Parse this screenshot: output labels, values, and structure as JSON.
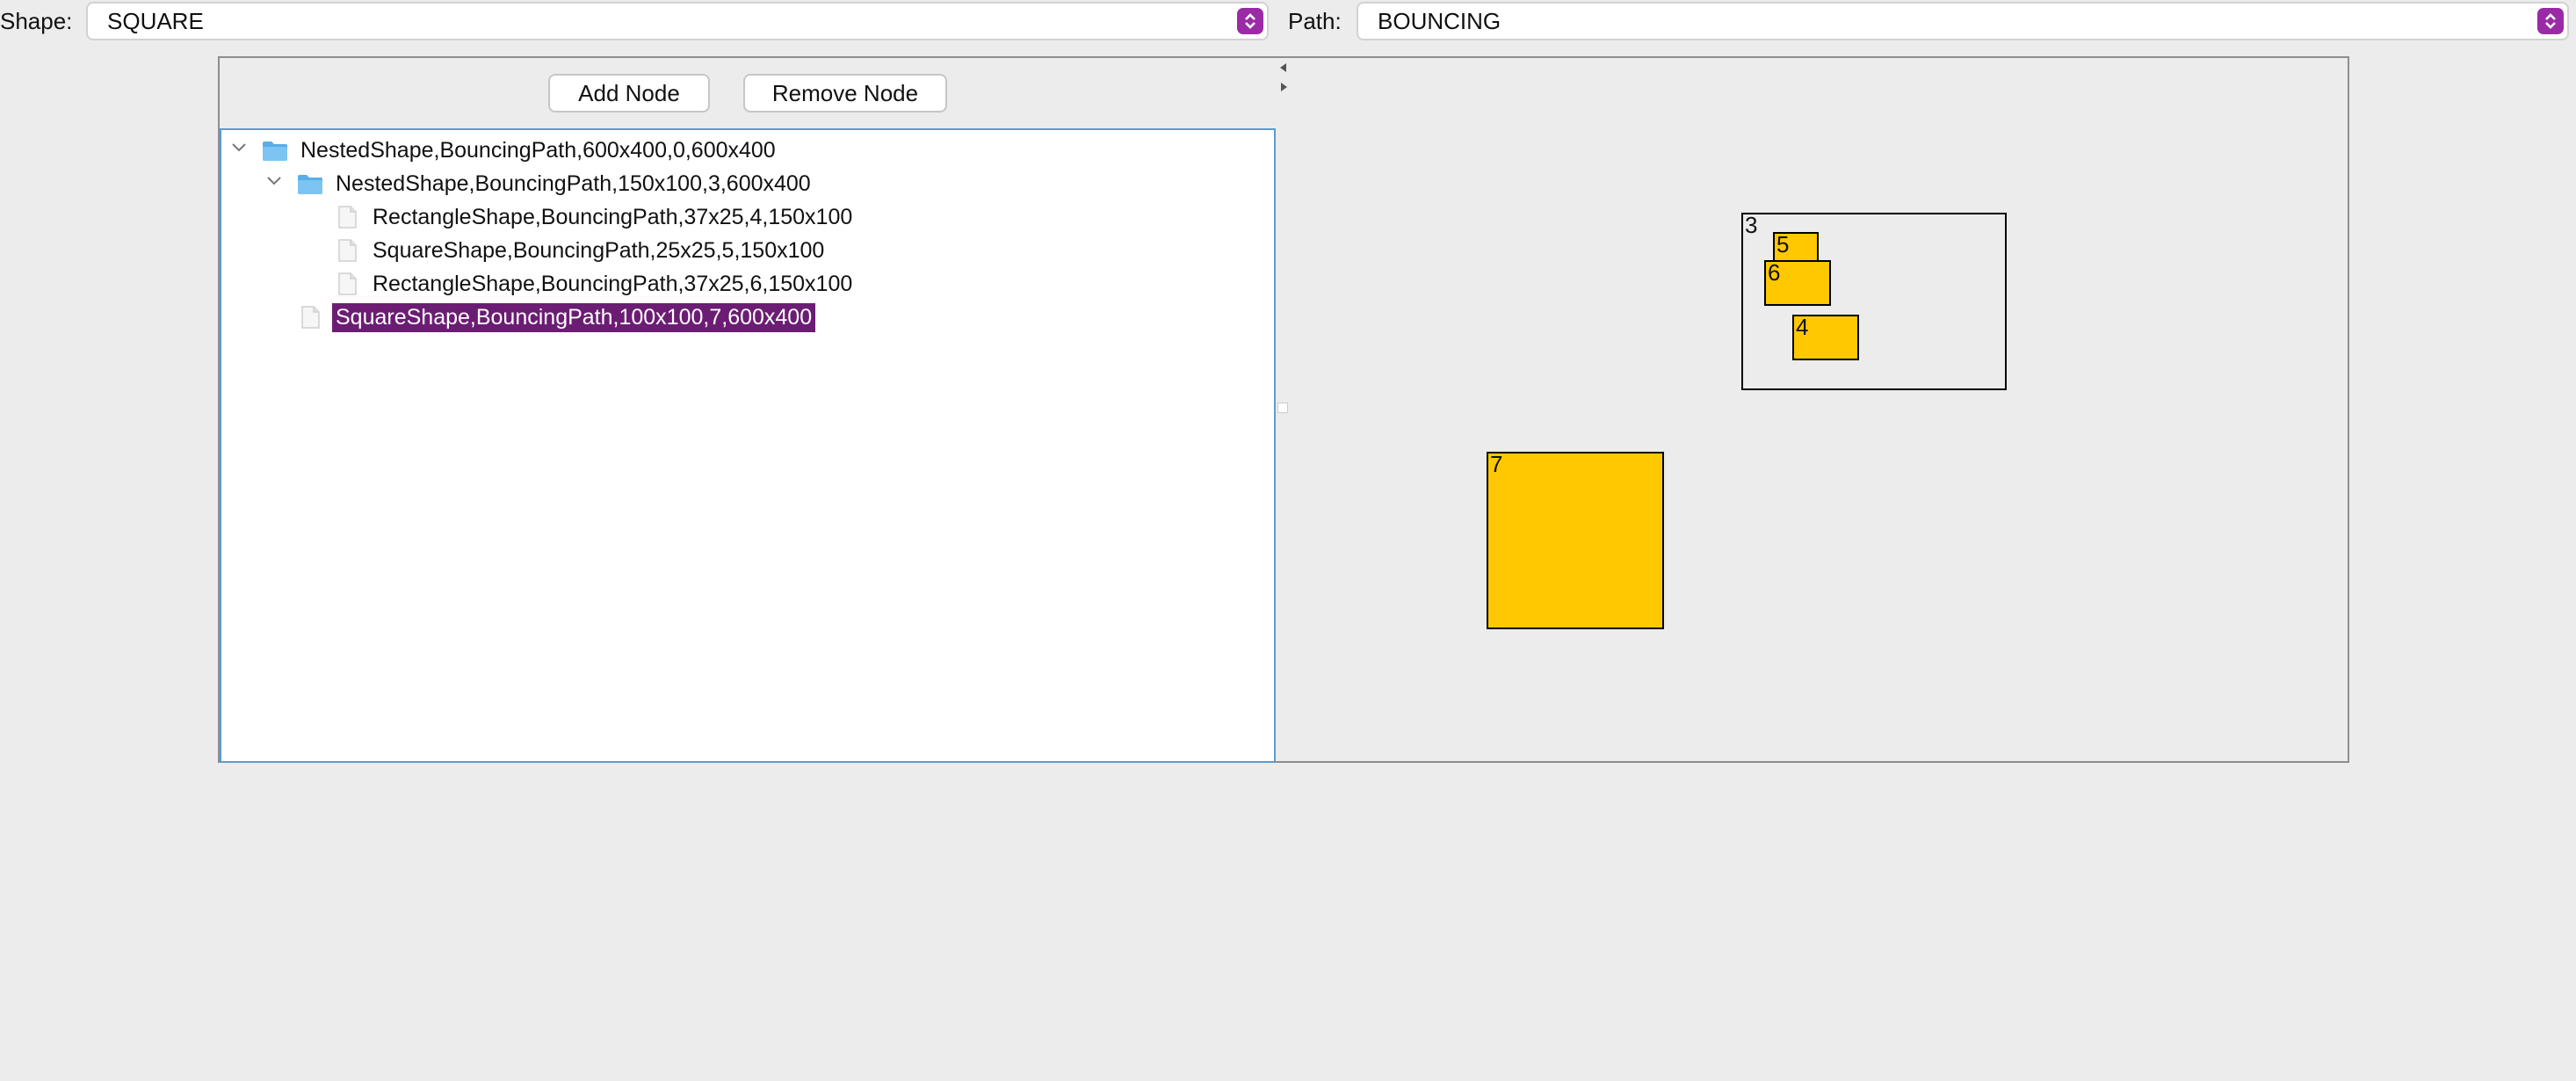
{
  "toolbar": {
    "shape_label": "Shape:",
    "shape_value": "SQUARE",
    "path_label": "Path:",
    "path_value": "BOUNCING",
    "accent_color": "#9b2aa7"
  },
  "buttons": {
    "add_node": "Add Node",
    "remove_node": "Remove Node"
  },
  "tree": {
    "nodes": [
      {
        "label": "NestedShape,BouncingPath,600x400,0,600x400",
        "type": "folder",
        "expanded": true,
        "depth": 0
      },
      {
        "label": "NestedShape,BouncingPath,150x100,3,600x400",
        "type": "folder",
        "expanded": true,
        "depth": 1
      },
      {
        "label": "RectangleShape,BouncingPath,37x25,4,150x100",
        "type": "leaf",
        "depth": 2
      },
      {
        "label": "SquareShape,BouncingPath,25x25,5,150x100",
        "type": "leaf",
        "depth": 2
      },
      {
        "label": "RectangleShape,BouncingPath,37x25,6,150x100",
        "type": "leaf",
        "depth": 2
      },
      {
        "label": "SquareShape,BouncingPath,100x100,7,600x400",
        "type": "leaf",
        "depth": 1,
        "selected": true
      }
    ],
    "selection_color": "#6b1d73"
  },
  "canvas": {
    "shape_fill": "#ffc800",
    "labels": {
      "nested": "3",
      "rect4": "4",
      "square5": "5",
      "rect6": "6",
      "square7": "7"
    }
  }
}
